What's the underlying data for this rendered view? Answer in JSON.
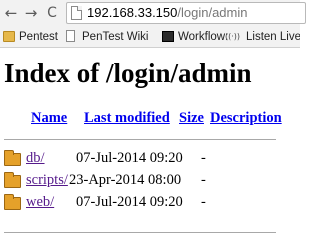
{
  "browser": {
    "url_host": "192.168.33.150",
    "url_path": "/login/admin",
    "back_glyph": "←",
    "forward_glyph": "→",
    "reload_glyph": "C"
  },
  "bookmarks": [
    {
      "label": "Pentest",
      "icon": "folder-icon"
    },
    {
      "label": "PenTest Wiki",
      "icon": "page-icon"
    },
    {
      "label": "Workflow:",
      "icon": "terminal-icon"
    },
    {
      "label": "Listen Live -",
      "icon": "wifi-icon",
      "glyph": "((·))"
    }
  ],
  "page": {
    "title": "Index of /login/admin",
    "columns": {
      "name": "Name",
      "last_modified": "Last modified",
      "size": "Size",
      "description": "Description"
    },
    "entries": [
      {
        "name": "db/",
        "modified": "07-Jul-2014 09:20",
        "size": "-",
        "icon": "folder-icon"
      },
      {
        "name": "scripts/",
        "modified": "23-Apr-2014 08:00",
        "size": "-",
        "icon": "folder-icon"
      },
      {
        "name": "web/",
        "modified": "07-Jul-2014 09:20",
        "size": "-",
        "icon": "folder-icon"
      }
    ]
  }
}
